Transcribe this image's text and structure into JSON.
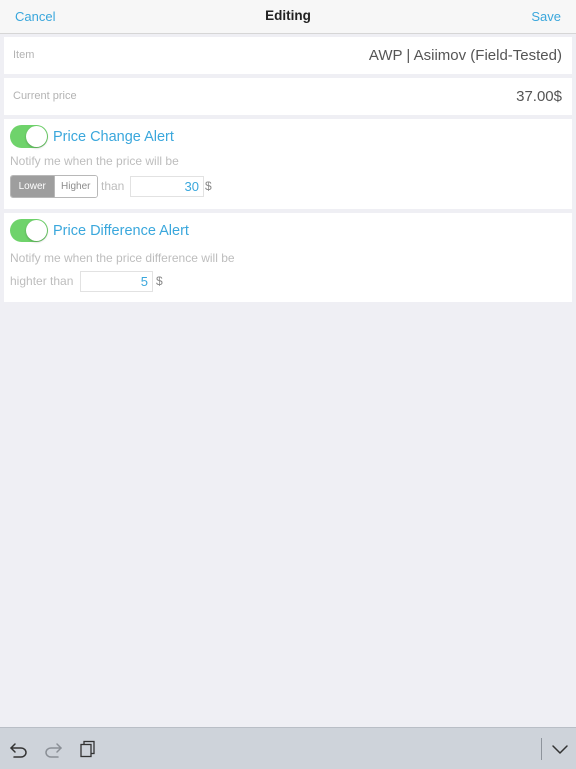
{
  "nav": {
    "cancel": "Cancel",
    "title": "Editing",
    "save": "Save"
  },
  "item": {
    "label": "Item",
    "value": "AWP | Asiimov (Field-Tested)"
  },
  "current_price": {
    "label": "Current price",
    "value": "37.00$"
  },
  "price_change_alert": {
    "enabled": true,
    "title": "Price Change Alert",
    "description": "Notify me when the price will be",
    "segment": {
      "options": [
        "Lower",
        "Higher"
      ],
      "selected": "Lower"
    },
    "than_label": "than",
    "amount": "30",
    "currency": "$"
  },
  "price_difference_alert": {
    "enabled": true,
    "title": "Price Difference Alert",
    "description": "Notify me when the price difference will be",
    "higher_than_label": "highter than",
    "amount": "5",
    "currency": "$"
  },
  "toolbar": {
    "icons": [
      "undo-icon",
      "redo-icon",
      "paste-icon",
      "chevron-down-icon"
    ]
  },
  "colors": {
    "accent": "#3aa7dc",
    "toggle_on": "#6fd36b",
    "background": "#efeff4"
  }
}
